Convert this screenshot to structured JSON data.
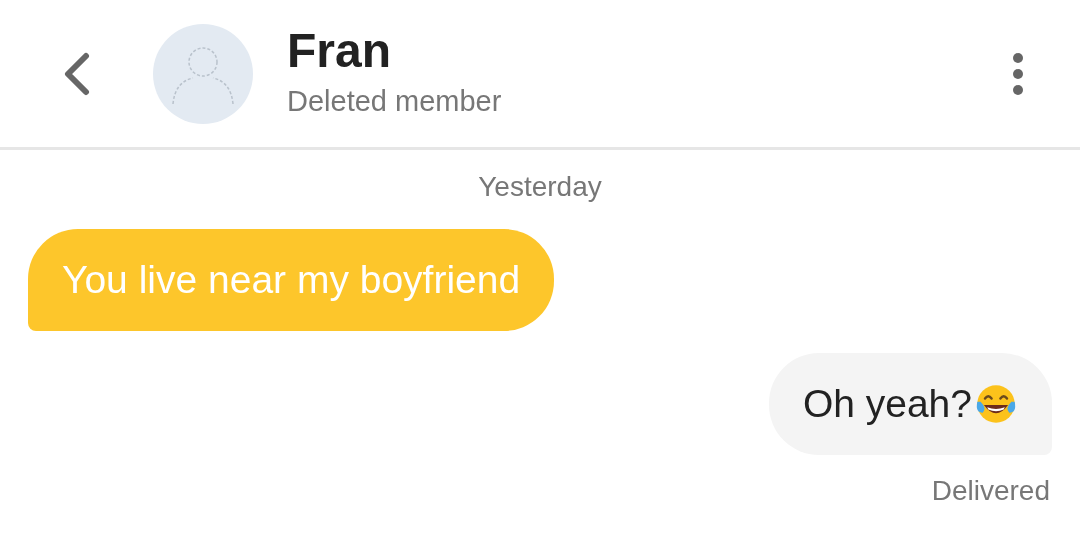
{
  "header": {
    "name": "Fran",
    "subtitle": "Deleted member"
  },
  "day_label": "Yesterday",
  "messages": [
    {
      "kind": "incoming",
      "text": "You live near my boyfriend"
    },
    {
      "kind": "outgoing",
      "text": "Oh yeah?",
      "emoji": true
    }
  ],
  "status": "Delivered"
}
